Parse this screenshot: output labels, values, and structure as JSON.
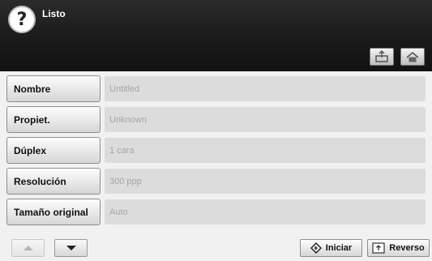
{
  "header": {
    "help_symbol": "?",
    "status_title": "Listo",
    "toolbar": [
      {
        "name": "tray-icon"
      },
      {
        "name": "home-icon"
      }
    ]
  },
  "params": [
    {
      "label": "Nombre",
      "value": "Untitled"
    },
    {
      "label": "Propiet.",
      "value": "Unknown"
    },
    {
      "label": "Dúplex",
      "value": "1 cara"
    },
    {
      "label": "Resolución",
      "value": "300 ppp"
    },
    {
      "label": "Tamaño original",
      "value": "Auto"
    }
  ],
  "footer": {
    "up_enabled": false,
    "down_enabled": true,
    "start_label": "Iniciar",
    "reverse_label": "Reverso"
  }
}
